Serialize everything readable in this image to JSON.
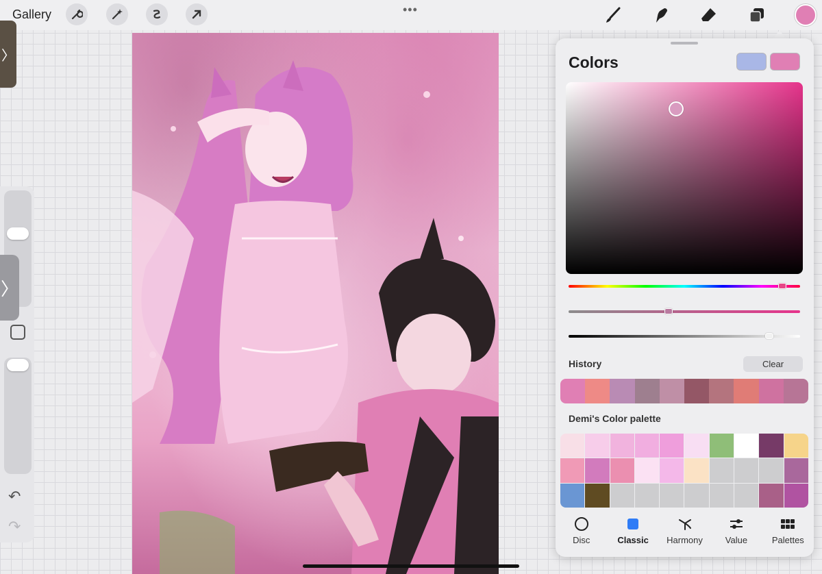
{
  "toolbar": {
    "gallery_label": "Gallery",
    "left_tools": [
      "wrench-icon",
      "magic-wand-icon",
      "selection-icon",
      "transform-arrow-icon"
    ],
    "right_tools": [
      "brush-icon",
      "smudge-icon",
      "eraser-icon",
      "layers-icon"
    ],
    "current_color": "#e07fb4"
  },
  "colors_panel": {
    "title": "Colors",
    "primary_color": "#a9b7e6",
    "secondary_color": "#e07fb4",
    "history_label": "History",
    "clear_label": "Clear",
    "history": [
      "#e07fb4",
      "#ee8a86",
      "#b98bb4",
      "#9e7f8f",
      "#bf8fa6",
      "#945766",
      "#b4747e",
      "#e07c76",
      "#cf72a0",
      "#b77596"
    ],
    "palette_label": "Demi's Color palette",
    "palette": [
      "#f8dfe7",
      "#f7cdea",
      "#f1b3de",
      "#f1aee0",
      "#ef9edc",
      "#f8def3",
      "#8fbe78",
      "#ffffff",
      "#763a67",
      "#f6d48a",
      "#f09ab6",
      "#d27bbd",
      "#eb8fb0",
      "#fbe1f3",
      "#f4b8e9",
      "#fbe2c5",
      "#cdcdcf",
      "#cdcdcf",
      "#cdcdcf",
      "#a9689c",
      "#6a96d3",
      "#5f4b22",
      "#cdcdcf",
      "#cdcdcf",
      "#cdcdcf",
      "#cdcdcf",
      "#cdcdcf",
      "#cdcdcf",
      "#a96088",
      "#b053a1"
    ],
    "tabs": [
      {
        "label": "Disc",
        "icon": "disc-icon"
      },
      {
        "label": "Classic",
        "icon": "classic-square-icon"
      },
      {
        "label": "Harmony",
        "icon": "harmony-icon"
      },
      {
        "label": "Value",
        "icon": "sliders-icon"
      },
      {
        "label": "Palettes",
        "icon": "palettes-grid-icon"
      }
    ],
    "active_tab": "Classic",
    "hue_slider_fraction": 0.94,
    "saturation_slider_fraction": 0.43,
    "brightness_slider_fraction": 0.88
  },
  "canvas": {
    "description_colors": {
      "primary": "#f0b6d6",
      "shadow": "#c1558f"
    }
  }
}
